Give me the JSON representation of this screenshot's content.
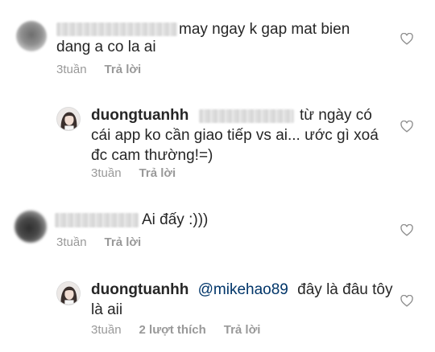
{
  "comments": [
    {
      "line1": "may ngay k gap mat bien",
      "line2": "dang a co la ai",
      "time": "3tuần",
      "reply": "Trả lời"
    },
    {
      "username": "duongtuanhh",
      "line1_tail": "từ ngày có",
      "line2": "cái app ko cần giao tiếp vs ai... ước gì xoá",
      "line3": "đc cam thường!=)",
      "time": "3tuần",
      "reply": "Trả lời"
    },
    {
      "line1": "Ai đấy :)))",
      "time": "3tuần",
      "reply": "Trả lời"
    },
    {
      "username": "duongtuanhh",
      "mention": "@mikehao89",
      "line1_tail": "đây là đâu tôy",
      "line2": "là aii",
      "time": "3tuần",
      "likes": "2 lượt thích",
      "reply": "Trả lời"
    }
  ],
  "icons": {
    "like": "heart-outline-icon"
  },
  "colors": {
    "text": "#262626",
    "meta": "#999999",
    "mention": "#003569"
  }
}
